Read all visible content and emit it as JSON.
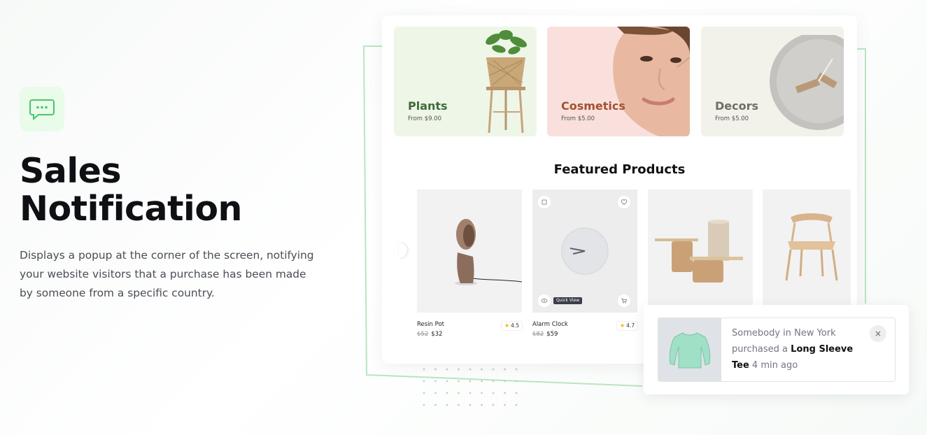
{
  "hero": {
    "title_line1": "Sales",
    "title_line2": "Notification",
    "description": "Displays a popup at the corner of the screen, notifying your website visitors that a purchase has been made by someone from a specific country.",
    "icon": "chat-bubble-icon",
    "accent_color": "#4cc46b"
  },
  "categories": [
    {
      "name": "Plants",
      "price": "From $9.00",
      "bg": "#eef6e8",
      "text_color": "#3f6b3a"
    },
    {
      "name": "Cosmetics",
      "price": "From $5.00",
      "bg": "#f9e0dc",
      "text_color": "#a4502f"
    },
    {
      "name": "Decors",
      "price": "From $5.00",
      "bg": "#f2f1ea",
      "text_color": "#6e6e66"
    }
  ],
  "featured": {
    "title": "Featured Products",
    "products": [
      {
        "name": "Resin Pot",
        "old_price": "$52",
        "price": "$32",
        "rating": "4.5"
      },
      {
        "name": "Alarm Clock",
        "old_price": "$82",
        "price": "$59",
        "rating": "4.7"
      }
    ],
    "quick_view_label": "Quick View"
  },
  "notification": {
    "prefix": "Somebody in New York purchased a",
    "product": "Long Sleeve Tee",
    "suffix": "4 min ago",
    "close_glyph": "×"
  }
}
